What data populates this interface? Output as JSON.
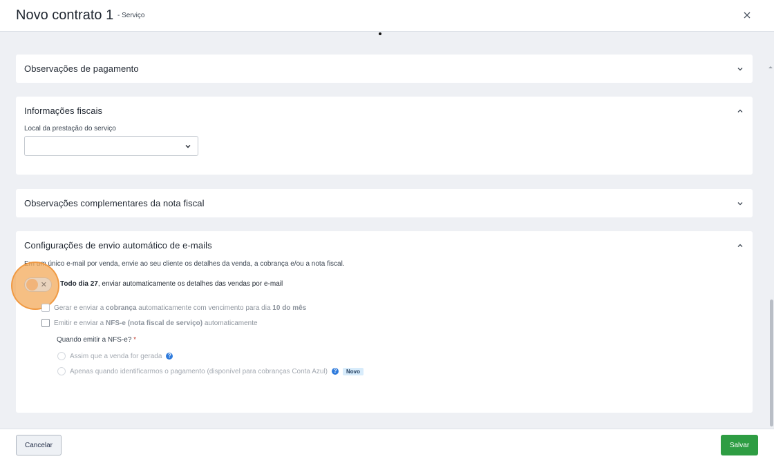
{
  "header": {
    "title": "Novo contrato 1",
    "subtitle": "- Serviço"
  },
  "sections": {
    "payment_notes": {
      "title": "Observações de pagamento",
      "expanded": false
    },
    "fiscal": {
      "title": "Informações fiscais",
      "expanded": true,
      "location_label": "Local da prestação do serviço",
      "location_value": ""
    },
    "invoice_notes": {
      "title": "Observações complementares da nota fiscal",
      "expanded": false
    },
    "emails": {
      "title": "Configurações de envio automático de e-mails",
      "expanded": true,
      "description": "Em um único e-mail por venda, envie ao seu cliente os detalhes da venda, a cobrança e/ou a nota fiscal.",
      "toggle": {
        "on": false,
        "bold": "Todo dia 27",
        "rest": ", enviar automaticamente os detalhes das vendas por e-mail"
      },
      "option_charge": {
        "checked": false,
        "pre": "Gerar e enviar a ",
        "bold1": "cobrança",
        "mid": " automaticamente com vencimento para dia ",
        "bold2": "10 do mês"
      },
      "option_nfse": {
        "checked": false,
        "pre": "Emitir e enviar a ",
        "bold1": "NFS-e (nota fiscal de serviço)",
        "post": " automaticamente"
      },
      "question": "Quando emitir a NFS-e?",
      "required_mark": "*",
      "radio_sale": "Assim que a venda for gerada",
      "radio_payment": "Apenas quando identificarmos o pagamento (disponível para cobranças Conta Azul)",
      "badge_new": "Novo",
      "help_glyph": "?"
    }
  },
  "footer": {
    "cancel_label": "Cancelar",
    "save_label": "Salvar"
  },
  "colors": {
    "accent_green": "#2e9d43",
    "help_blue": "#2f7bdc",
    "highlight_orange": "#f3aa5a"
  },
  "icons": {
    "close": "close-icon",
    "chevron_down": "chevron-down-icon",
    "chevron_up": "chevron-up-icon",
    "toggle_off": "x-icon",
    "help": "help-icon"
  }
}
